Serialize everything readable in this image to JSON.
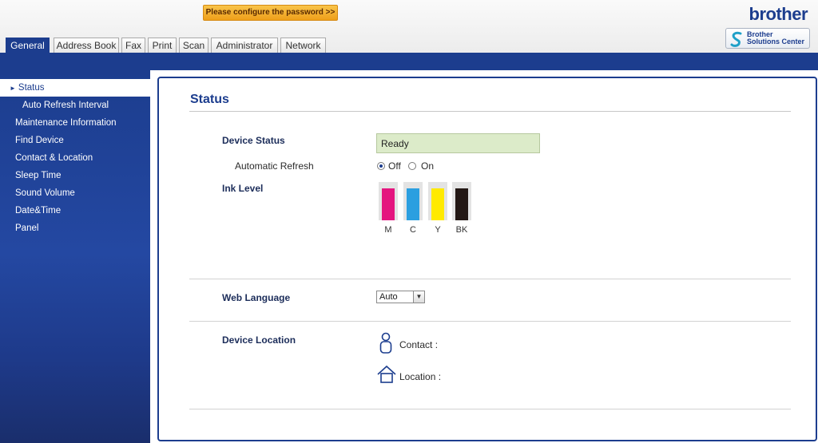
{
  "header": {
    "password_warning": "Please configure the password >>",
    "logo_text": "brother",
    "solutions_center": {
      "line1": "Brother",
      "line2": "Solutions Center"
    },
    "brand_color": "#1c3d8e",
    "warning_color": "#f1a82a"
  },
  "tabs": [
    {
      "label": "General",
      "active": true
    },
    {
      "label": "Address Book"
    },
    {
      "label": "Fax"
    },
    {
      "label": "Print"
    },
    {
      "label": "Scan"
    },
    {
      "label": "Administrator"
    },
    {
      "label": "Network"
    }
  ],
  "sidebar": {
    "items": [
      {
        "label": "Status",
        "active": true
      },
      {
        "label": "Auto Refresh Interval"
      },
      {
        "label": "Maintenance Information"
      },
      {
        "label": "Find Device"
      },
      {
        "label": "Contact & Location"
      },
      {
        "label": "Sleep Time"
      },
      {
        "label": "Sound Volume"
      },
      {
        "label": "Date&Time"
      },
      {
        "label": "Panel"
      }
    ]
  },
  "main": {
    "title": "Status",
    "device_status": {
      "label": "Device Status",
      "value": "Ready"
    },
    "auto_refresh": {
      "label": "Automatic Refresh",
      "off": "Off",
      "on": "On",
      "selected": "Off"
    },
    "ink_level": {
      "label": "Ink Level",
      "cartridges": [
        {
          "name": "M",
          "color": "#e4157f",
          "level": 1.0
        },
        {
          "name": "C",
          "color": "#2b9fe0",
          "level": 1.0
        },
        {
          "name": "Y",
          "color": "#ffea00",
          "level": 1.0
        },
        {
          "name": "BK",
          "color": "#231815",
          "level": 1.0
        }
      ]
    },
    "web_language": {
      "label": "Web Language",
      "value": "Auto"
    },
    "device_location": {
      "label": "Device Location",
      "contact": "Contact :",
      "location": "Location :"
    }
  }
}
